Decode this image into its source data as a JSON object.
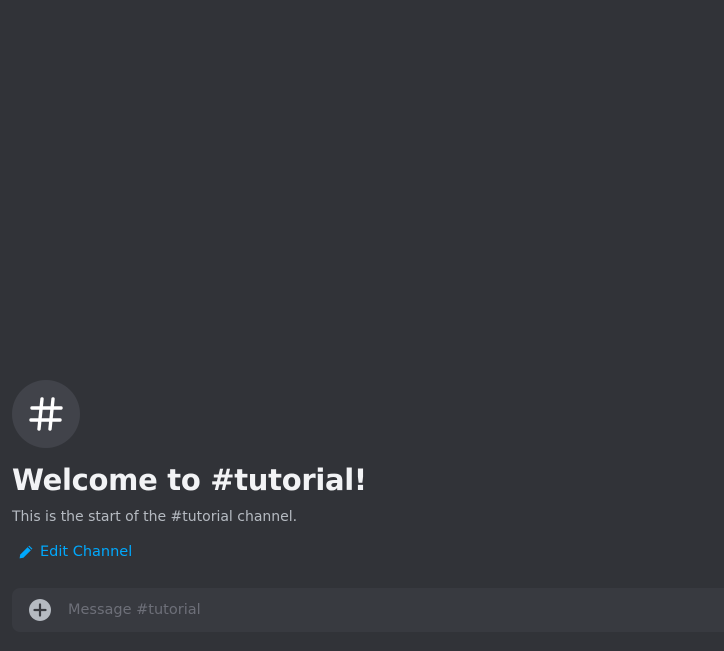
{
  "channel": {
    "avatar_icon": "hash-icon",
    "welcome_title": "Welcome to #tutorial!",
    "welcome_subtitle": "This is the start of the #tutorial channel.",
    "edit_label": "Edit Channel",
    "edit_icon": "pencil-icon"
  },
  "composer": {
    "add_icon": "plus-circle-icon",
    "placeholder": "Message #tutorial",
    "value": ""
  },
  "colors": {
    "background": "#313338",
    "avatar_bg": "#41434a",
    "composer_bg": "#383a40",
    "link": "#00a8fc",
    "title": "#f2f3f5",
    "subtitle": "#b5bac1"
  }
}
